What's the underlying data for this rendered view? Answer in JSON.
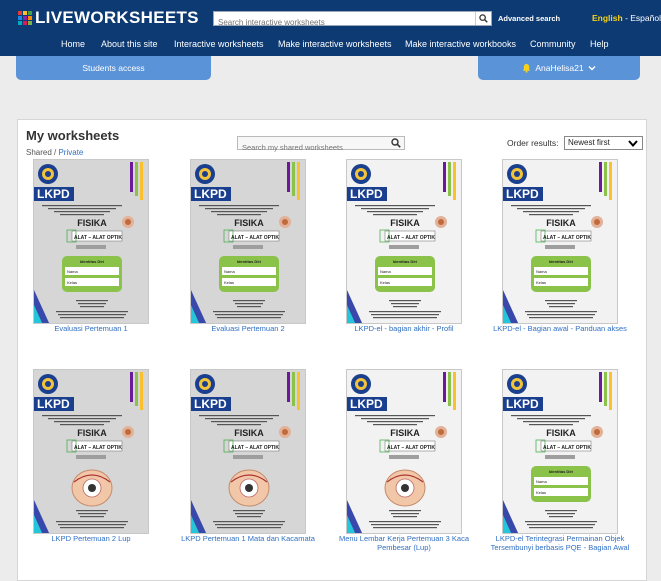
{
  "header": {
    "logo_text": "LIVEWORKSHEETS",
    "logo_colors": [
      "#e53935",
      "#fbc02d",
      "#43a047",
      "#1e88e5",
      "#8e24aa",
      "#fb8c00",
      "#00acc1",
      "#d81b60",
      "#7cb342"
    ],
    "search_placeholder": "Search interactive worksheets",
    "advanced_search": "Advanced search",
    "lang_english": "English",
    "lang_sep": " - ",
    "lang_spanish": "Español",
    "nav": [
      "Home",
      "About this site",
      "Interactive worksheets",
      "Make interactive worksheets",
      "Make interactive workbooks",
      "Community",
      "Help"
    ]
  },
  "subbar": {
    "students_access": "Students access",
    "username": "AnaHelisa21"
  },
  "main": {
    "title": "My worksheets",
    "shared_label": "Shared",
    "shared_sep": " / ",
    "private_label": "Private",
    "search_placeholder": "Search my shared worksheets",
    "order_label": "Order results:",
    "order_value": "Newest first"
  },
  "thumb": {
    "lkpd": "LKPD",
    "fisika": "FISIKA",
    "subtitle": "ALAT – ALAT OPTIK",
    "identitas": "Identitas Diri",
    "nama": "Nama",
    "kelas": "Kelas"
  },
  "worksheets": [
    {
      "title": "Evaluasi Pertemuan 1",
      "light": false,
      "variant": "form"
    },
    {
      "title": "Evaluasi Pertemuan 2",
      "light": false,
      "variant": "form"
    },
    {
      "title": "LKPD-el - bagian akhir - Profil",
      "light": true,
      "variant": "form"
    },
    {
      "title": "LKPD-el - Bagian awal - Panduan akses",
      "light": true,
      "variant": "form"
    },
    {
      "title": "LKPD Pertemuan 2 Lup",
      "light": false,
      "variant": "eye"
    },
    {
      "title": "LKPD Pertemuan 1 Mata dan Kacamata",
      "light": false,
      "variant": "eye"
    },
    {
      "title": "Menu Lembar Kerja Pertemuan 3 Kaca Pembesar (Lup)",
      "light": true,
      "variant": "eye"
    },
    {
      "title": "LKPD-el Terintegrasi Permainan Objek Tersembunyi berbasis PQE - Bagian Awal",
      "light": true,
      "variant": "form"
    }
  ],
  "colors": {
    "header": "#0d3a73",
    "subbar": "#5b93d8",
    "link": "#2f6fc4",
    "lkpd_blue": "#1a3f8f",
    "form_green": "#8bc34a"
  }
}
